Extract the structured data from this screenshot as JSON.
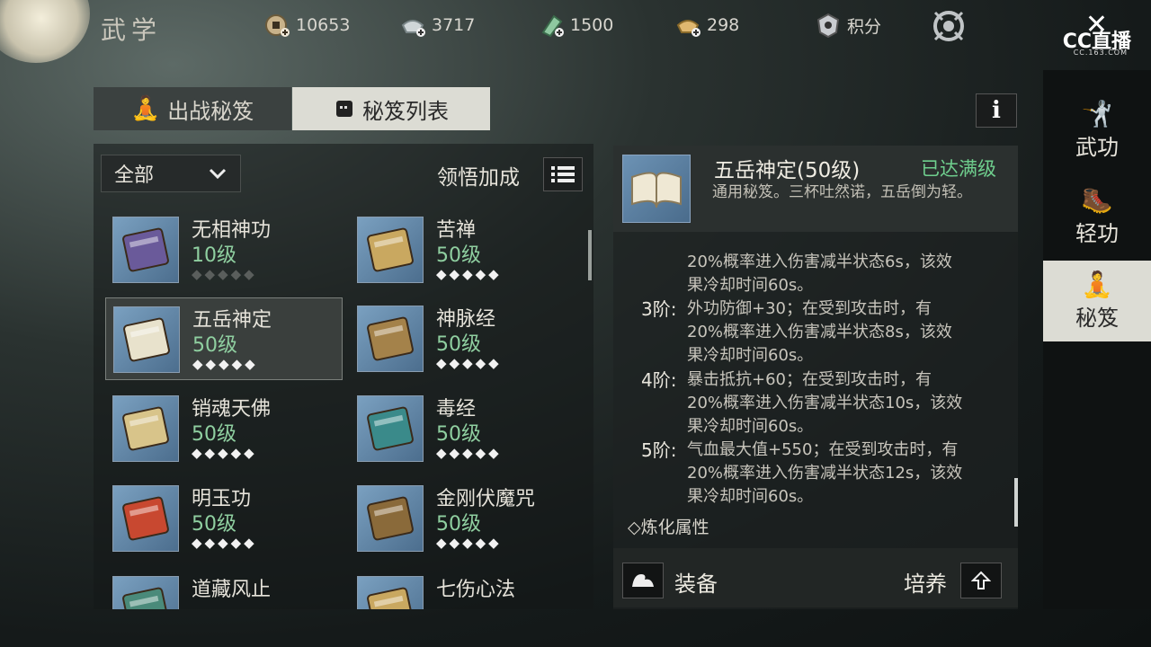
{
  "header": {
    "title": "武学",
    "resources": [
      {
        "icon": "copper-coin-icon",
        "value": "10653"
      },
      {
        "icon": "silver-ingot-icon",
        "value": "3717"
      },
      {
        "icon": "jade-token-icon",
        "value": "1500"
      },
      {
        "icon": "gold-ingot-icon",
        "value": "298"
      }
    ],
    "points_label": "积分",
    "overlay_logo": "CC直播",
    "overlay_sub": "CC.163.COM"
  },
  "tabs": [
    {
      "label": "出战秘笈",
      "icon": "meditation-icon",
      "active": false
    },
    {
      "label": "秘笈列表",
      "icon": "book-list-icon",
      "active": true
    }
  ],
  "filter": {
    "selected": "全部",
    "bonus_label": "领悟加成"
  },
  "books": [
    {
      "name": "无相神功",
      "level": "10级",
      "stars": "◆◆◆◆◆",
      "stars_lit": false,
      "color": "#6a5a9a"
    },
    {
      "name": "苦禅",
      "level": "50级",
      "stars": "◆◆◆◆◆",
      "stars_lit": true,
      "color": "#c9a860"
    },
    {
      "name": "五岳神定",
      "level": "50级",
      "stars": "◆◆◆◆◆",
      "stars_lit": true,
      "color": "#e8e2cc"
    },
    {
      "name": "神脉经",
      "level": "50级",
      "stars": "◆◆◆◆◆",
      "stars_lit": true,
      "color": "#a4824a"
    },
    {
      "name": "销魂天佛",
      "level": "50级",
      "stars": "◆◆◆◆◆",
      "stars_lit": true,
      "color": "#d8c48a"
    },
    {
      "name": "毒经",
      "level": "50级",
      "stars": "◆◆◆◆◆",
      "stars_lit": true,
      "color": "#3a8a8a"
    },
    {
      "name": "明玉功",
      "level": "50级",
      "stars": "◆◆◆◆◆",
      "stars_lit": true,
      "color": "#c84830"
    },
    {
      "name": "金刚伏魔咒",
      "level": "50级",
      "stars": "◆◆◆◆◆",
      "stars_lit": true,
      "color": "#8a6a3a"
    },
    {
      "name": "道藏风止",
      "level": "",
      "stars": "",
      "stars_lit": true,
      "color": "#4a8a7a"
    },
    {
      "name": "七伤心法",
      "level": "",
      "stars": "",
      "stars_lit": true,
      "color": "#c9a860"
    }
  ],
  "detail": {
    "name": "五岳神定(50级)",
    "status": "已达满级",
    "description": "通用秘笈。三杯吐然诺，五岳倒为轻。",
    "lines": [
      {
        "tier": "",
        "text": "20%概率进入伤害减半状态6s，该效"
      },
      {
        "tier": "",
        "text": "果冷却时间60s。"
      },
      {
        "tier": "3阶:",
        "text": "外功防御+30；在受到攻击时，有"
      },
      {
        "tier": "",
        "text": "20%概率进入伤害减半状态8s，该效"
      },
      {
        "tier": "",
        "text": "果冷却时间60s。"
      },
      {
        "tier": "4阶:",
        "text": "暴击抵抗+60；在受到攻击时，有"
      },
      {
        "tier": "",
        "text": "20%概率进入伤害减半状态10s，该效"
      },
      {
        "tier": "",
        "text": "果冷却时间60s。"
      },
      {
        "tier": "5阶:",
        "text": "气血最大值+550；在受到攻击时，有"
      },
      {
        "tier": "",
        "text": "20%概率进入伤害减半状态12s，该效"
      },
      {
        "tier": "",
        "text": "果冷却时间60s。"
      }
    ],
    "refine_label": "◇炼化属性",
    "equip_label": "装备",
    "cultivate_label": "培养"
  },
  "sidenav": [
    {
      "label": "武功",
      "icon": "martial-arts-icon",
      "active": false
    },
    {
      "label": "轻功",
      "icon": "qinggong-icon",
      "active": false
    },
    {
      "label": "秘笈",
      "icon": "meditation-icon",
      "active": true
    }
  ]
}
